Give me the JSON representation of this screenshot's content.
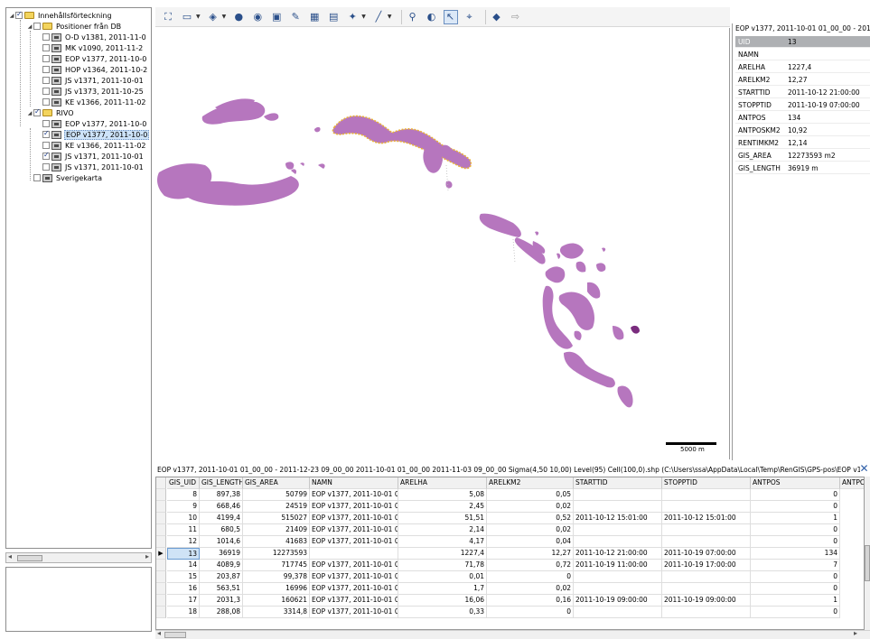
{
  "tree": {
    "root_label": "Innehållsförteckning",
    "groups": [
      {
        "label": "Positioner från DB",
        "items": [
          {
            "label": "O-D v1381, 2011-11-0",
            "checked": false
          },
          {
            "label": "MK v1090, 2011-11-2",
            "checked": false
          },
          {
            "label": "EOP v1377, 2011-10-0",
            "checked": false
          },
          {
            "label": "HOP v1364, 2011-10-2",
            "checked": false
          },
          {
            "label": "JS v1371, 2011-10-01",
            "checked": false
          },
          {
            "label": "JS v1373, 2011-10-25",
            "checked": false
          },
          {
            "label": "KE v1366, 2011-11-02",
            "checked": false
          }
        ]
      },
      {
        "label": "RIVO",
        "items": [
          {
            "label": "EOP v1377, 2011-10-0",
            "checked": false
          },
          {
            "label": "EOP v1377, 2011-10-0",
            "checked": true
          },
          {
            "label": "KE v1366, 2011-11-02",
            "checked": false
          },
          {
            "label": "JS v1371, 2011-10-01",
            "checked": true
          },
          {
            "label": "JS v1371, 2011-10-01",
            "checked": false
          }
        ]
      }
    ],
    "extra_item": "Sverigekarta"
  },
  "toolbar": {
    "icons": [
      "zoom-extent-icon",
      "open-folder-icon",
      "layer-add-icon",
      "globe-icon",
      "sphere-icon",
      "select-area-icon",
      "edit-icon",
      "table-icon",
      "save-icon",
      "paint-icon",
      "draw-line-icon",
      "zoom-in-icon",
      "zoom-out-icon",
      "select-arrow-icon",
      "identify-icon",
      "back-icon",
      "forward-icon"
    ]
  },
  "map": {
    "scale_label": "5000 m",
    "fill_color": "#b676be",
    "highlight_color": "#e8b13a"
  },
  "attributes": {
    "title": "EOP v1377, 2011-10-01 01_00_00 - 201",
    "rows": [
      {
        "key": "UID",
        "value": "13"
      },
      {
        "key": "NAMN",
        "value": ""
      },
      {
        "key": "ARELHA",
        "value": "1227,4"
      },
      {
        "key": "ARELKM2",
        "value": "12,27"
      },
      {
        "key": "STARTTID",
        "value": "2011-10-12 21:00:00"
      },
      {
        "key": "STOPPTID",
        "value": "2011-10-19 07:00:00"
      },
      {
        "key": "ANTPOS",
        "value": "134"
      },
      {
        "key": "ANTPOSKM2",
        "value": "10,92"
      },
      {
        "key": "RENTIMKM2",
        "value": "12,14"
      },
      {
        "key": "GIS_AREA",
        "value": "12273593 m2"
      },
      {
        "key": "GIS_LENGTH",
        "value": "36919 m"
      }
    ]
  },
  "grid": {
    "caption": "EOP v1377, 2011-10-01 01_00_00 - 2011-12-23 09_00_00 2011-10-01 01_00_00 2011-11-03 09_00_00 Sigma(4,50 10,00) Level(95) Cell(100,0).shp (C:\\Users\\ssa\\AppData\\Local\\Temp\\RenGIS\\GPS-pos\\EOP v137",
    "columns": [
      "GIS_UID",
      "GIS_LENGTH",
      "GIS_AREA",
      "NAMN",
      "ARELHA",
      "ARELKM2",
      "STARTTID",
      "STOPPTID",
      "ANTPOS",
      "ANTPC"
    ],
    "rows": [
      [
        "8",
        "897,38",
        "50799",
        "EOP v1377, 2011-10-01 0",
        "5,08",
        "0,05",
        "",
        "",
        "0"
      ],
      [
        "9",
        "668,46",
        "24519",
        "EOP v1377, 2011-10-01 0",
        "2,45",
        "0,02",
        "",
        "",
        "0"
      ],
      [
        "10",
        "4199,4",
        "515027",
        "EOP v1377, 2011-10-01 0",
        "51,51",
        "0,52",
        "2011-10-12 15:01:00",
        "2011-10-12 15:01:00",
        "1"
      ],
      [
        "11",
        "680,5",
        "21409",
        "EOP v1377, 2011-10-01 0",
        "2,14",
        "0,02",
        "",
        "",
        "0"
      ],
      [
        "12",
        "1014,6",
        "41683",
        "EOP v1377, 2011-10-01 0",
        "4,17",
        "0,04",
        "",
        "",
        "0"
      ],
      [
        "13",
        "36919",
        "12273593",
        "",
        "1227,4",
        "12,27",
        "2011-10-12 21:00:00",
        "2011-10-19 07:00:00",
        "134"
      ],
      [
        "14",
        "4089,9",
        "717745",
        "EOP v1377, 2011-10-01 0",
        "71,78",
        "0,72",
        "2011-10-19 11:00:00",
        "2011-10-19 17:00:00",
        "7"
      ],
      [
        "15",
        "203,87",
        "99,378",
        "EOP v1377, 2011-10-01 0",
        "0,01",
        "0",
        "",
        "",
        "0"
      ],
      [
        "16",
        "563,51",
        "16996",
        "EOP v1377, 2011-10-01 0",
        "1,7",
        "0,02",
        "",
        "",
        "0"
      ],
      [
        "17",
        "2031,3",
        "160621",
        "EOP v1377, 2011-10-01 0",
        "16,06",
        "0,16",
        "2011-10-19 09:00:00",
        "2011-10-19 09:00:00",
        "1"
      ],
      [
        "18",
        "288,08",
        "3314,8",
        "EOP v1377, 2011-10-01 0",
        "0,33",
        "0",
        "",
        "",
        "0"
      ]
    ],
    "current_row_index": 5
  }
}
